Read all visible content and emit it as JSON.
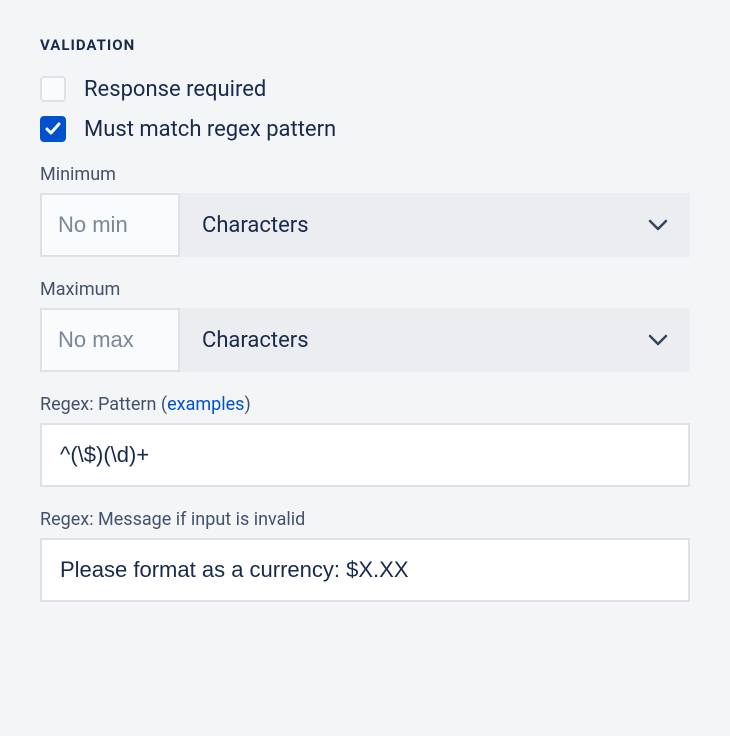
{
  "heading": "VALIDATION",
  "checkboxes": {
    "response_required": {
      "label": "Response required",
      "checked": false
    },
    "must_match_regex": {
      "label": "Must match regex pattern",
      "checked": true
    }
  },
  "minimum": {
    "label": "Minimum",
    "placeholder": "No min",
    "value": "",
    "unit": "Characters"
  },
  "maximum": {
    "label": "Maximum",
    "placeholder": "No max",
    "value": "",
    "unit": "Characters"
  },
  "regex_pattern": {
    "label_prefix": "Regex: Pattern (",
    "label_link": "examples",
    "label_suffix": ")",
    "value": "^(\\$)(\\d)+"
  },
  "regex_message": {
    "label": "Regex: Message if input is invalid",
    "value": "Please format as a currency: $X.XX"
  }
}
